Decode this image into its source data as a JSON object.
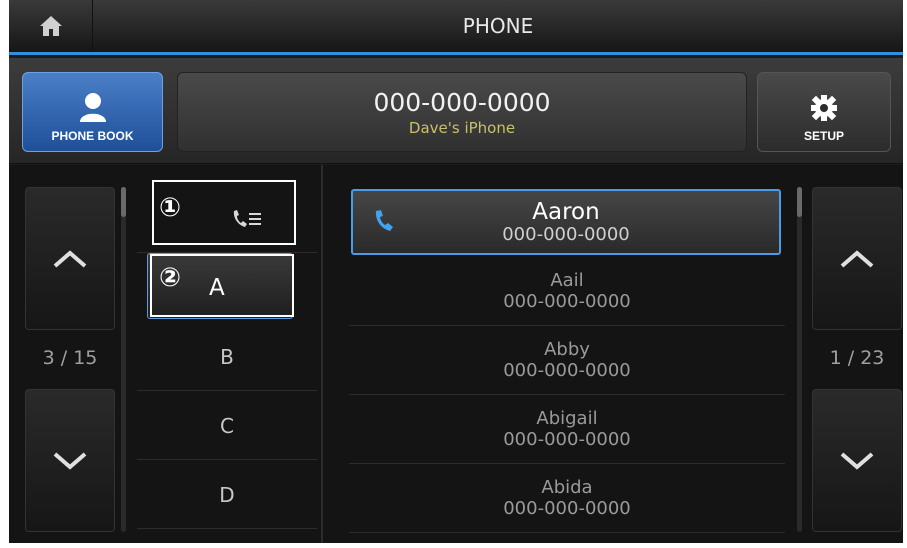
{
  "titlebar": {
    "title": "PHONE",
    "home_icon": "home-icon"
  },
  "header": {
    "phonebook_label": "PHONE BOOK",
    "device_number": "000-000-0000",
    "device_name": "Dave's iPhone",
    "setup_label": "SETUP"
  },
  "alpha": {
    "left_page": "3 / 15",
    "callout_1": "①",
    "callout_2": "②",
    "selected": "A",
    "items": [
      "B",
      "C",
      "D"
    ]
  },
  "contacts": {
    "right_page": "1 / 23",
    "list": [
      {
        "name": "Aaron",
        "number": "000-000-0000"
      },
      {
        "name": "Aail",
        "number": "000-000-0000"
      },
      {
        "name": "Abby",
        "number": "000-000-0000"
      },
      {
        "name": "Abigail",
        "number": "000-000-0000"
      },
      {
        "name": "Abida",
        "number": "000-000-0000"
      }
    ]
  },
  "colors": {
    "accent": "#4a9be8",
    "device_name": "#c8c06a"
  }
}
